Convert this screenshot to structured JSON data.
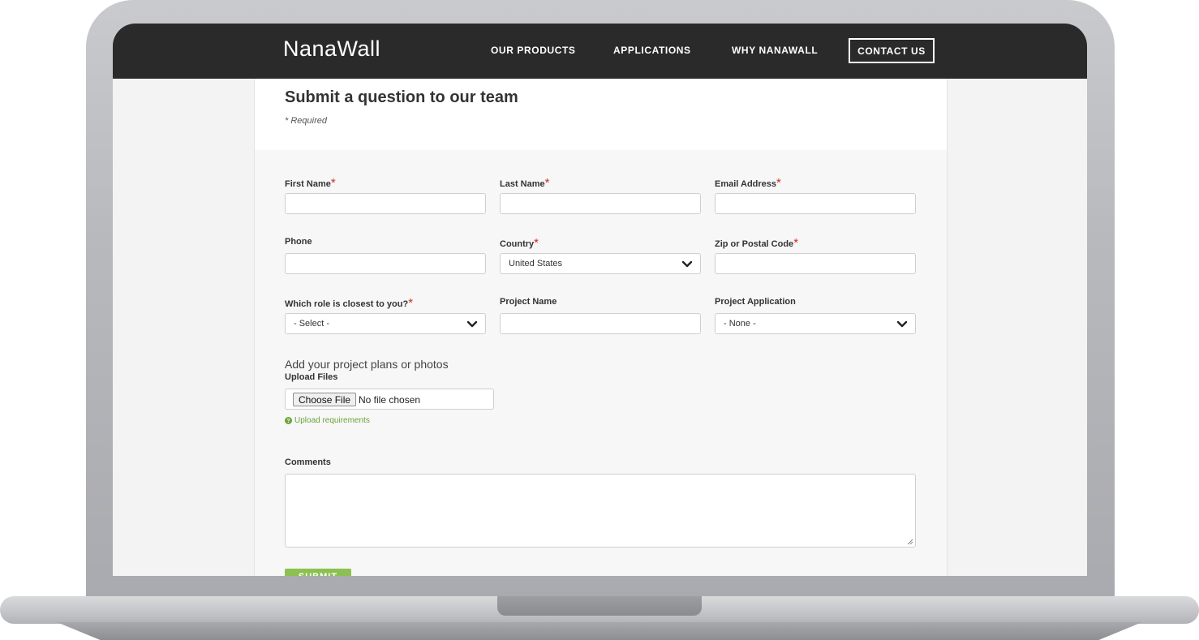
{
  "nav": {
    "logo": "NanaWall",
    "items": [
      "OUR PRODUCTS",
      "APPLICATIONS",
      "WHY NANAWALL"
    ],
    "contact": "CONTACT US"
  },
  "form": {
    "title": "Submit a question to our team",
    "required_note": "* Required",
    "required_marker": "*",
    "fields": {
      "first_name": "First Name",
      "last_name": "Last Name",
      "email": "Email Address",
      "phone": "Phone",
      "country": "Country",
      "zip": "Zip or Postal Code",
      "role": "Which role is closest to you?",
      "project_name": "Project Name",
      "project_application": "Project Application",
      "comments": "Comments"
    },
    "selects": {
      "country_value": "United States",
      "role_value": "- Select -",
      "project_application_value": "- None -"
    },
    "upload": {
      "heading": "Add your project plans or photos",
      "label": "Upload Files",
      "button": "Choose File",
      "status": "No file chosen",
      "requirements": "Upload requirements"
    },
    "submit": "SUBMIT"
  },
  "colors": {
    "navbar": "#2a2a2a",
    "required": "#d52b1e",
    "accent_green": "#8cc152"
  }
}
